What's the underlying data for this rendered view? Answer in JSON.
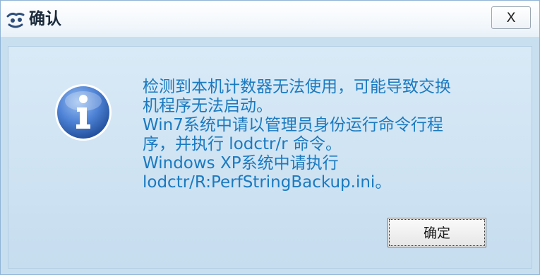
{
  "window": {
    "title": "确认",
    "close_label": "X",
    "app_icon": "eye-logo-icon"
  },
  "dialog": {
    "icon": "info-icon",
    "message_lines": [
      "检测到本机计数器无法使用，可能导致交换",
      "机程序无法启动。",
      "Win7系统中请以管理员身份运行命令行程",
      "序，并执行 lodctr/r 命令。",
      "Windows XP系统中请执行",
      "lodctr/R:PerfStringBackup.ini。"
    ],
    "ok_label": "确定"
  },
  "colors": {
    "message_text": "#1a7ac0",
    "panel_background": "#c8dff0",
    "info_icon": "#3a6fc4"
  }
}
